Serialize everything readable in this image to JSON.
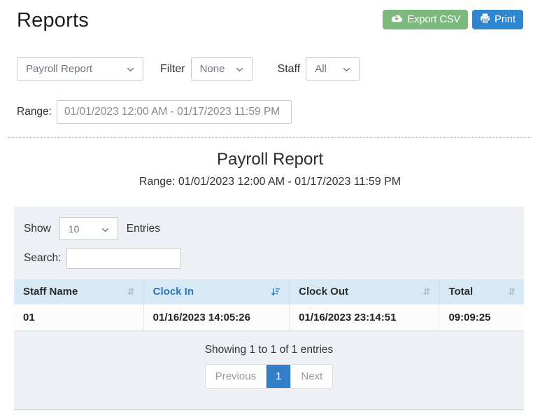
{
  "page": {
    "title": "Reports"
  },
  "toolbar": {
    "export_label": "Export CSV",
    "print_label": "Print"
  },
  "filters": {
    "report_select_value": "Payroll Report",
    "filter_label": "Filter",
    "filter_select_value": "None",
    "staff_label": "Staff",
    "staff_select_value": "All",
    "range_label": "Range:",
    "range_value": "01/01/2023 12:00 AM - 01/17/2023 11:59 PM"
  },
  "report": {
    "heading": "Payroll Report",
    "subheading": "Range: 01/01/2023 12:00 AM - 01/17/2023 11:59 PM"
  },
  "table_controls": {
    "show_label": "Show",
    "show_value": "10",
    "entries_label": "Entries",
    "search_label": "Search:",
    "search_value": ""
  },
  "table": {
    "columns": [
      {
        "label": "Staff Name",
        "sorted": false
      },
      {
        "label": "Clock In",
        "sorted": true,
        "sort_direction": "desc"
      },
      {
        "label": "Clock Out",
        "sorted": false
      },
      {
        "label": "Total",
        "sorted": false
      }
    ],
    "rows": [
      [
        "01",
        "01/16/2023 14:05:26",
        "01/16/2023 23:14:51",
        "09:09:25"
      ]
    ]
  },
  "pagination": {
    "summary": "Showing 1 to 1 of 1 entries",
    "previous_label": "Previous",
    "current_page": "1",
    "next_label": "Next"
  },
  "icons": {
    "export": "cloud-download-icon",
    "print": "printer-icon",
    "select": "chevron-down-icon",
    "sorted": "sort-amount-down-icon",
    "unsorted": "sort-both-icon"
  },
  "colors": {
    "export_green": "#7cb97c",
    "print_blue": "#2e86d1",
    "active_page_blue": "#337fc9",
    "table_header_bg": "#d8e9f6",
    "panel_bg": "#edf1f5",
    "sorted_text_blue": "#2a74c0"
  }
}
